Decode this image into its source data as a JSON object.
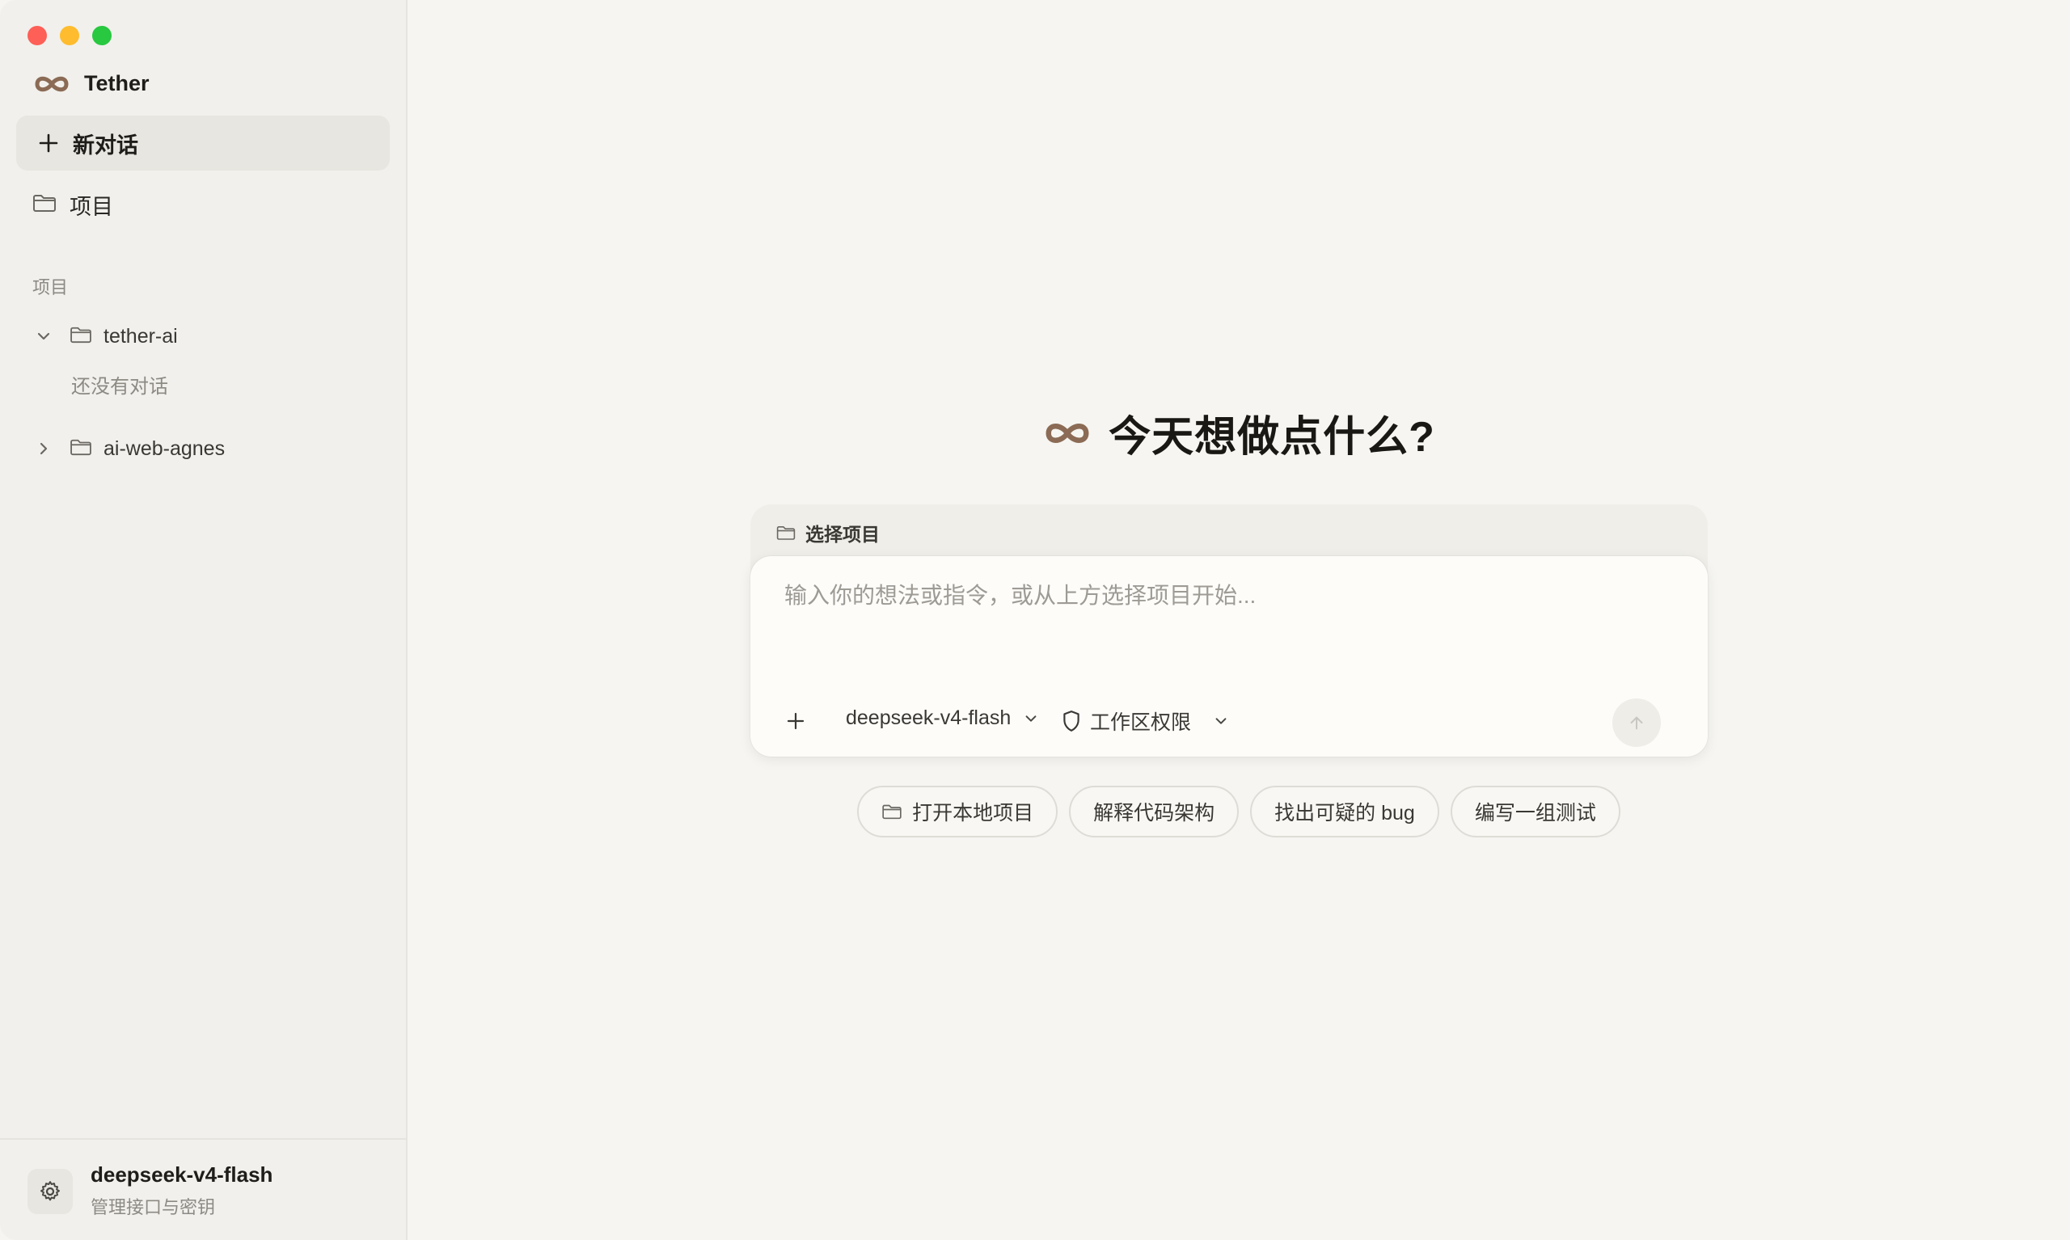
{
  "window": {
    "controls": [
      "close",
      "minimize",
      "zoom"
    ]
  },
  "sidebar": {
    "brand": {
      "name": "Tether",
      "logo_icon": "infinity-logo-icon"
    },
    "new_chat_label": "新对话",
    "projects_nav_label": "项目",
    "section_label": "项目",
    "projects": [
      {
        "name": "tether-ai",
        "expanded": true,
        "empty_text": "还没有对话"
      },
      {
        "name": "ai-web-agnes",
        "expanded": false
      }
    ],
    "footer": {
      "model": "deepseek-v4-flash",
      "subtitle": "管理接口与密钥"
    }
  },
  "main": {
    "hero_title": "今天想做点什么?",
    "composer": {
      "project_tab_label": "选择项目",
      "placeholder": "输入你的想法或指令，或从上方选择项目开始...",
      "model": "deepseek-v4-flash",
      "permission": "工作区权限"
    },
    "suggestions": [
      {
        "label": "打开本地项目",
        "icon": "folder-icon"
      },
      {
        "label": "解释代码架构"
      },
      {
        "label": "找出可疑的 bug"
      },
      {
        "label": "编写一组测试"
      }
    ]
  },
  "colors": {
    "accent_logo": "#8b6b55",
    "sidebar_bg": "#f1f0ec",
    "main_bg": "#f6f5f1"
  }
}
